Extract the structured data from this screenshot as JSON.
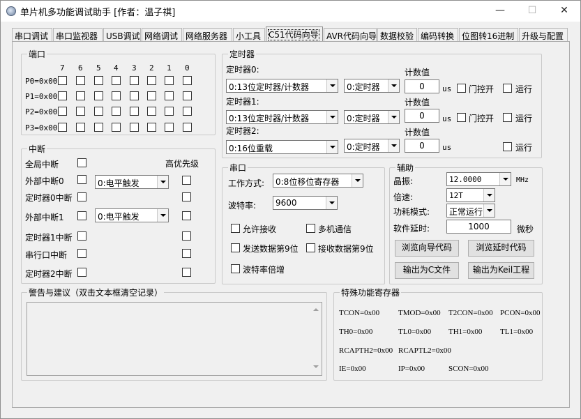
{
  "window": {
    "title": "单片机多功能调试助手 [作者：温子祺]",
    "minimize": "—",
    "maximize": "☐",
    "close": "✕"
  },
  "tabs": [
    "串口调试",
    "串口监视器",
    "USB调试",
    "网络调试",
    "网络服务器",
    "小工具",
    "C51代码向导",
    "AVR代码向导",
    "数据校验",
    "编码转换",
    "位图转16进制",
    "升级与配置"
  ],
  "port": {
    "title": "端口",
    "bits": [
      "7",
      "6",
      "5",
      "4",
      "3",
      "2",
      "1",
      "0"
    ],
    "rows": [
      "P0=0x00",
      "P1=0x00",
      "P2=0x00",
      "P3=0x00"
    ]
  },
  "interrupt": {
    "title": "中断",
    "high_priority": "高优先级",
    "global": "全局中断",
    "ext0": "外部中断0",
    "ext0_mode": "0:电平触发",
    "timer0": "定时器0中断",
    "ext1": "外部中断1",
    "ext1_mode": "0:电平触发",
    "timer1": "定时器1中断",
    "serial": "串行口中断",
    "timer2": "定时器2中断"
  },
  "timer": {
    "title": "定时器",
    "count_label": "计数值",
    "us": "us",
    "gate": "门控开",
    "run": "运行",
    "t0_label": "定时器0:",
    "t0_mode": "0:13位定时器/计数器",
    "t0_func": "0:定时器",
    "t0_count": "0",
    "t1_label": "定时器1:",
    "t1_mode": "0:13位定时器/计数器",
    "t1_func": "0:定时器",
    "t1_count": "0",
    "t2_label": "定时器2:",
    "t2_mode": "0:16位重载",
    "t2_func": "0:定时器",
    "t2_count": "0"
  },
  "serial": {
    "title": "串口",
    "mode_label": "工作方式:",
    "mode_value": "0:8位移位寄存器",
    "baud_label": "波特率:",
    "baud_value": "9600",
    "allow_recv": "允许接收",
    "multi_comm": "多机通信",
    "send_bit9": "发送数据第9位",
    "recv_bit9": "接收数据第9位",
    "baud_double": "波特率倍增"
  },
  "aux": {
    "title": "辅助",
    "crystal_label": "晶振:",
    "crystal_value": "12.0000",
    "crystal_unit": "MHz",
    "speed_label": "倍速:",
    "speed_value": "12T",
    "power_label": "功耗模式:",
    "power_value": "正常运行",
    "delay_label": "软件延时:",
    "delay_value": "1000",
    "delay_unit": "微秒",
    "btn_browse_wizard": "浏览向导代码",
    "btn_browse_delay": "浏览延时代码",
    "btn_export_c": "输出为C文件",
    "btn_export_keil": "输出为Keil工程"
  },
  "warnings": {
    "title": "警告与建议（双击文本框清空记录）",
    "content": ""
  },
  "sfr": {
    "title": "特殊功能寄存器",
    "rows": [
      [
        "TCON=0x00",
        "TMOD=0x00",
        "T2CON=0x00",
        "PCON=0x00"
      ],
      [
        "TH0=0x00",
        "TL0=0x00",
        "TH1=0x00",
        "TL1=0x00"
      ],
      [
        "RCAPTH2=0x00",
        "RCAPTL2=0x00",
        "",
        ""
      ],
      [
        "IE=0x00",
        "IP=0x00",
        "SCON=0x00",
        ""
      ]
    ]
  }
}
